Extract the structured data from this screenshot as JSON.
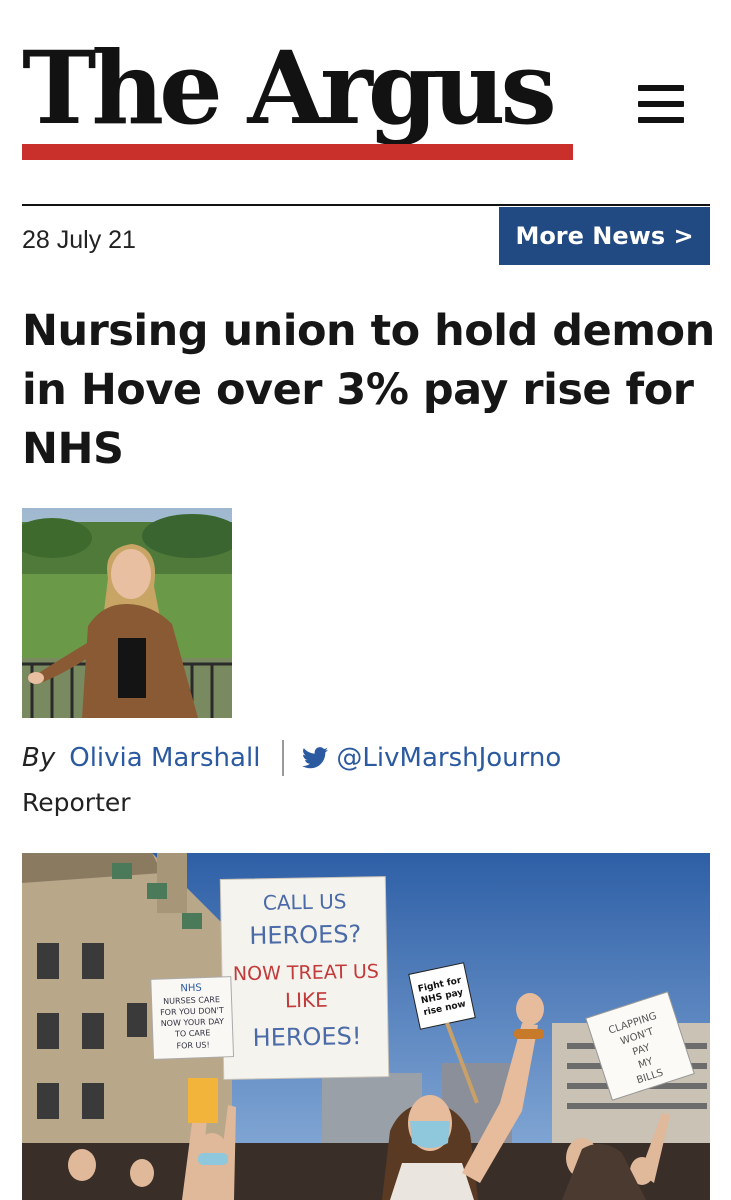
{
  "site": {
    "name": "The Argus",
    "brand_color": "#c9302c"
  },
  "menu": {
    "icon": "hamburger-menu-icon"
  },
  "meta": {
    "date": "28 July 21",
    "more_news_label": "More News >",
    "more_news_color": "#224a82"
  },
  "article": {
    "headline": "Nursing union to hold demon in Hove over 3% pay rise for NHS"
  },
  "author": {
    "by_label": "By",
    "name": "Olivia Marshall",
    "twitter_handle": "@LivMarshJourno",
    "role": "Reporter",
    "link_color": "#2c5aa0"
  },
  "photo_signs": {
    "main_lines": [
      "CALL US",
      "HEROES?",
      "NOW TREAT US",
      "LIKE",
      "HEROES!"
    ],
    "left_lines": [
      "NHS",
      "NURSES CARE",
      "FOR YOU DON'T",
      "NOW YOUR DAY",
      "TO CARE",
      "FOR US!"
    ],
    "fight_lines": [
      "Fight for",
      "NHS pay",
      "rise now"
    ],
    "right_lines": [
      "CLAPPING",
      "WON'T",
      "PAY",
      "MY",
      "BILLS"
    ]
  }
}
